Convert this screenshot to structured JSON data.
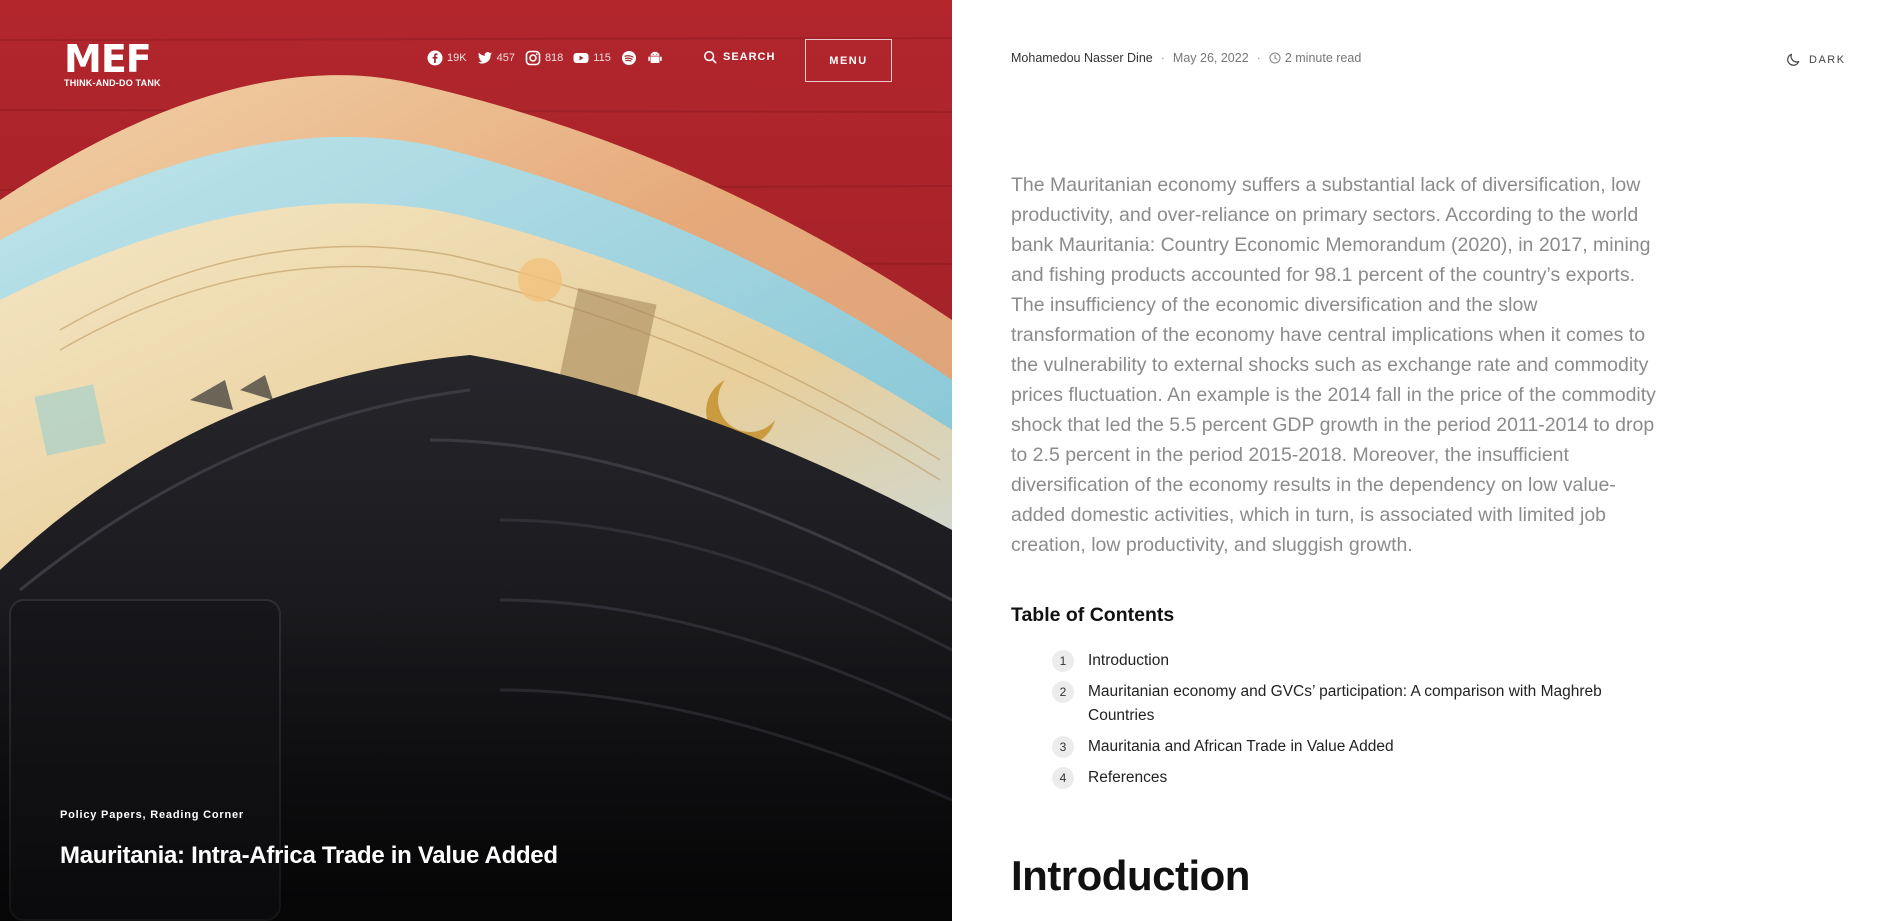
{
  "brand": {
    "logo_text": "MEF",
    "logo_sub": "THINK-AND-DO TANK"
  },
  "nav": {
    "socials": [
      {
        "icon": "facebook-icon",
        "count": "19K"
      },
      {
        "icon": "twitter-icon",
        "count": "457"
      },
      {
        "icon": "instagram-icon",
        "count": "818"
      },
      {
        "icon": "youtube-icon",
        "count": "115"
      },
      {
        "icon": "spotify-icon",
        "count": ""
      },
      {
        "icon": "android-icon",
        "count": ""
      }
    ],
    "search_label": "SEARCH",
    "menu_label": "MENU"
  },
  "hero": {
    "categories": "Policy Papers, Reading Corner",
    "title": "Mauritania: Intra-Africa Trade in Value Added"
  },
  "meta": {
    "author": "Mohamedou Nasser Dine",
    "date": "May 26, 2022",
    "read_time": "2 minute read",
    "dark_label": "DARK"
  },
  "article": {
    "lead": "The Mauritanian economy suffers a substantial lack of diversification, low productivity, and over-reliance on primary sectors. According to the world bank Mauritania: Country Economic Memorandum (2020), in 2017, mining and fishing products accounted for 98.1 percent of the country’s exports. The insufficiency of the economic diversification and the slow transformation of the economy have central implications when it comes to the vulnerability to external shocks such as exchange rate and commodity prices fluctuation. An example is the 2014 fall in the price of the commodity shock that led the 5.5 percent GDP growth in the period 2011-2014 to drop to 2.5 percent in the period 2015-2018. Moreover, the insufficient diversification of the economy results in the dependency on low value-added domestic activities, which in turn, is associated with limited job creation, low productivity, and sluggish growth.",
    "toc_title": "Table of Contents",
    "toc": [
      {
        "num": "1",
        "label": "Introduction"
      },
      {
        "num": "2",
        "label": "Mauritanian economy and GVCs’ participation: A comparison with Maghreb Countries"
      },
      {
        "num": "3",
        "label": "Mauritania and African Trade in Value Added"
      },
      {
        "num": "4",
        "label": "References"
      }
    ],
    "intro_heading": "Introduction"
  },
  "colors": {
    "hero_red": "#a3242b",
    "wallet_black": "#141417",
    "lead_gray": "#8b8b8b"
  }
}
